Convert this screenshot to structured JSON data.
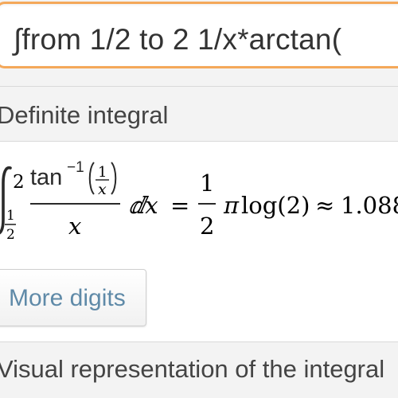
{
  "search": {
    "query": "∫from 1/2 to 2  1/x*arctan("
  },
  "pods": {
    "definite_integral": {
      "title": "Definite integral"
    },
    "visual": {
      "title": "Visual representation of the integral"
    }
  },
  "result": {
    "upper_limit": "2",
    "lower_limit_num": "1",
    "lower_limit_den": "2",
    "func_name": "tan",
    "func_exponent": "−1",
    "arg_num": "1",
    "arg_den": "x",
    "denominator": "x",
    "differential": "ⅆx",
    "equals": "=",
    "coef_num": "1",
    "coef_den": "2",
    "pi": "π",
    "log_expr": "log(2)",
    "approx": "≈",
    "decimal": "1.088"
  },
  "buttons": {
    "more_digits": "More digits"
  },
  "colors": {
    "input_border": "#f4a85a",
    "header_background": "#f3f3f3",
    "button_text": "#5f8aa8"
  }
}
